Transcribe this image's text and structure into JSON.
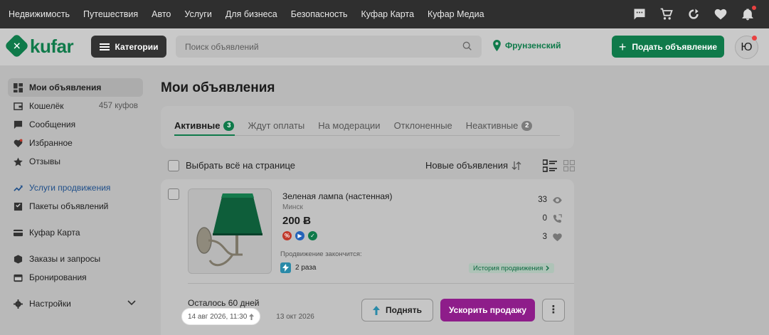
{
  "topnav": {
    "links": [
      "Недвижимость",
      "Путешествия",
      "Авто",
      "Услуги",
      "Для бизнеса",
      "Безопасность",
      "Куфар Карта",
      "Куфар Медиа"
    ],
    "icons": [
      "chat-icon",
      "cart-icon",
      "compare-icon",
      "heart-icon",
      "bell-icon"
    ]
  },
  "header": {
    "logo_text": "kufar",
    "categories_label": "Категории",
    "search_placeholder": "Поиск объявлений",
    "region": "Фрунзенский",
    "post_ad_label": "Подать объявление",
    "avatar_initial": "Ю",
    "brand_color": "#0f7a4a"
  },
  "sidebar": {
    "items": [
      {
        "label": "Мои объявления",
        "icon": "grid-icon",
        "active": true
      },
      {
        "label": "Кошелёк",
        "icon": "wallet-icon",
        "count": "457 куфов"
      },
      {
        "label": "Сообщения",
        "icon": "message-icon"
      },
      {
        "label": "Избранное",
        "icon": "heart-icon"
      },
      {
        "label": "Отзывы",
        "icon": "star-icon"
      },
      {
        "label": "Услуги продвижения",
        "icon": "trend-up-icon"
      },
      {
        "label": "Пакеты объявлений",
        "icon": "package-icon"
      },
      {
        "label": "Куфар Карта",
        "icon": "card-icon"
      },
      {
        "label": "Заказы и запросы",
        "icon": "box-icon"
      },
      {
        "label": "Бронирования",
        "icon": "calendar-icon"
      },
      {
        "label": "Настройки",
        "icon": "gear-icon"
      }
    ]
  },
  "main": {
    "title": "Мои объявления",
    "tabs": [
      {
        "label": "Активные",
        "badge": "3"
      },
      {
        "label": "Ждут оплаты"
      },
      {
        "label": "На модерации"
      },
      {
        "label": "Отклоненные"
      },
      {
        "label": "Неактивные",
        "badge": "2"
      }
    ],
    "select_all_label": "Выбрать всё на странице",
    "sort_label": "Новые объявления"
  },
  "ad": {
    "title": "Зеленая лампа (настенная)",
    "city": "Минск",
    "price": "200 Ƀ",
    "promo_label": "Продвижение закончится:",
    "promo_count": "2 раза",
    "history_label": "История продвижения",
    "stats": {
      "views": "33",
      "calls": "0",
      "favorites": "3"
    },
    "days_left": "Осталось 60 дней",
    "date_start": "14 авг 2026, 11:30",
    "date_end": "13 окт 2026",
    "raise_label": "Поднять",
    "boost_label": "Ускорить продажу",
    "boost_color": "#8e1d8a",
    "more_glyph": "⋮"
  }
}
